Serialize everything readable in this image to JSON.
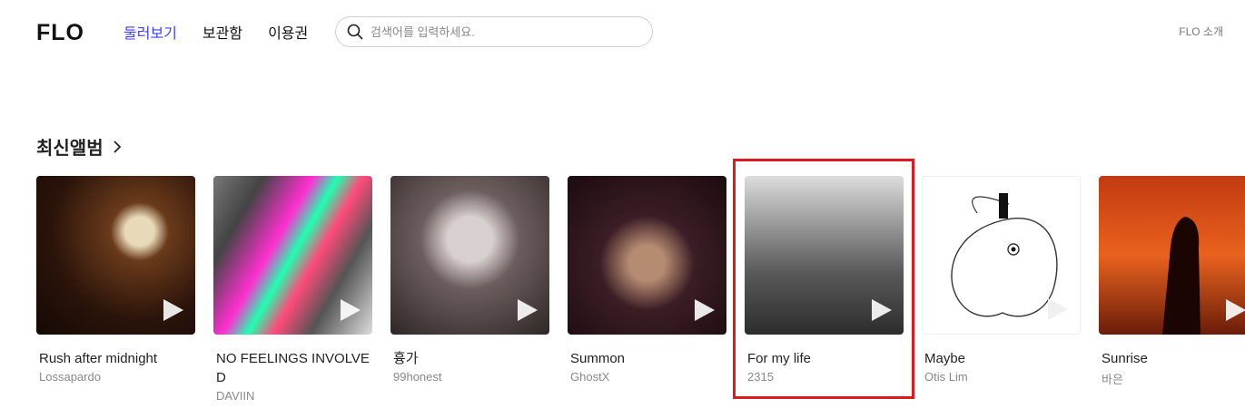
{
  "header": {
    "logo_text": "FLO",
    "nav": [
      "둘러보기",
      "보관함",
      "이용권"
    ],
    "active_nav": "둘러보기",
    "search_placeholder": "검색어를 입력하세요.",
    "intro_link": "FLO 소개"
  },
  "section": {
    "title": "최신앨범",
    "albums": [
      {
        "title": "Rush after midnight",
        "artist": "Lossapardo"
      },
      {
        "title": "NO FEELINGS INVOLVED",
        "artist": "DAVIIN"
      },
      {
        "title": "흉가",
        "artist": "99honest"
      },
      {
        "title": "Summon",
        "artist": "GhostX"
      },
      {
        "title": "For my life",
        "artist": "2315"
      },
      {
        "title": "Maybe",
        "artist": "Otis Lim"
      },
      {
        "title": "Sunrise",
        "artist": "바은"
      }
    ]
  },
  "colors": {
    "accent": "#3f3fff",
    "highlight": "#e0191f"
  }
}
